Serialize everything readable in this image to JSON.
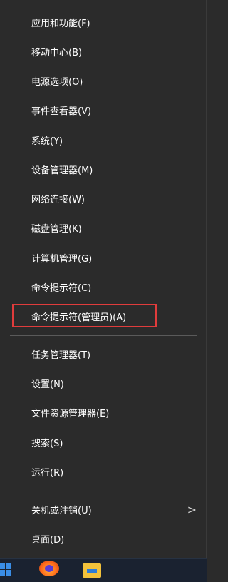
{
  "menu": {
    "items": [
      {
        "label": "应用和功能(F)"
      },
      {
        "label": "移动中心(B)"
      },
      {
        "label": "电源选项(O)"
      },
      {
        "label": "事件查看器(V)"
      },
      {
        "label": "系统(Y)"
      },
      {
        "label": "设备管理器(M)"
      },
      {
        "label": "网络连接(W)"
      },
      {
        "label": "磁盘管理(K)"
      },
      {
        "label": "计算机管理(G)"
      },
      {
        "label": "命令提示符(C)"
      },
      {
        "label": "命令提示符(管理员)(A)"
      },
      {
        "label": "任务管理器(T)"
      },
      {
        "label": "设置(N)"
      },
      {
        "label": "文件资源管理器(E)"
      },
      {
        "label": "搜索(S)"
      },
      {
        "label": "运行(R)"
      },
      {
        "label": "关机或注销(U)",
        "has_submenu": true
      },
      {
        "label": "桌面(D)"
      }
    ],
    "highlighted_item": "命令提示符(管理员)(A)",
    "highlight_color": "#e03c3c",
    "submenu_chevron": ">"
  },
  "taskbar": {
    "icons": [
      "windows-start-icon",
      "firefox-icon",
      "file-explorer-icon"
    ]
  },
  "colors": {
    "menu_bg": "#2b2b2b",
    "text": "#ffffff",
    "separator": "#5a5a5a",
    "taskbar_bg": "#1a2230"
  }
}
